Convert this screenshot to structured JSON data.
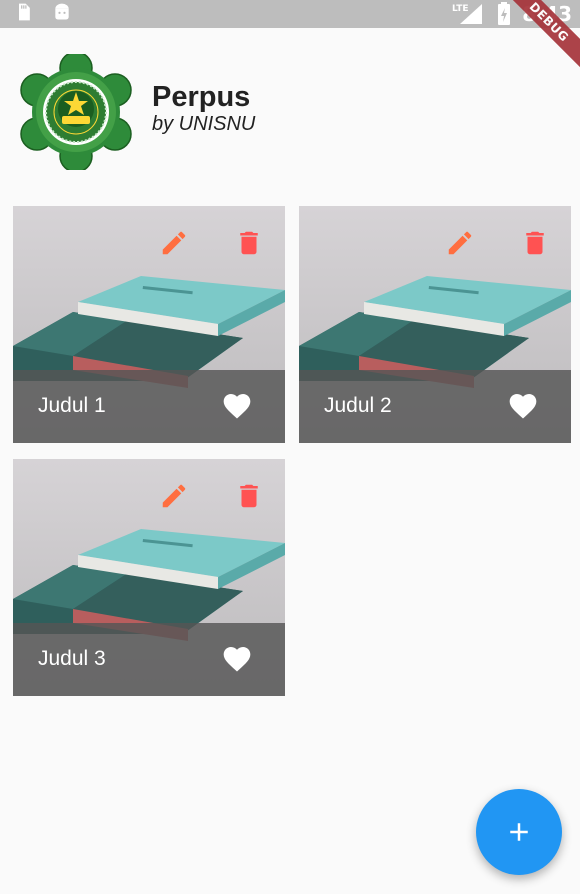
{
  "status_bar": {
    "time": "8:43",
    "network": "LTE",
    "icons": [
      "sd-card-icon",
      "android-icon",
      "signal-icon",
      "battery-charging-icon"
    ],
    "debug_banner": "DEBUG"
  },
  "header": {
    "title": "Perpus",
    "subtitle": "by UNISNU",
    "logo": "unisnu-logo"
  },
  "books": [
    {
      "title": "Judul 1",
      "favorite": true
    },
    {
      "title": "Judul 2",
      "favorite": true
    },
    {
      "title": "Judul 3",
      "favorite": true
    }
  ],
  "icons": {
    "edit": "edit-icon",
    "delete": "delete-icon",
    "favorite": "heart-icon",
    "add": "add-icon"
  },
  "colors": {
    "accent": "#2196f3",
    "edit_icon": "#ff6e40",
    "delete_icon": "#ff5252",
    "card_footer": "#555555",
    "background": "#fafafa"
  }
}
